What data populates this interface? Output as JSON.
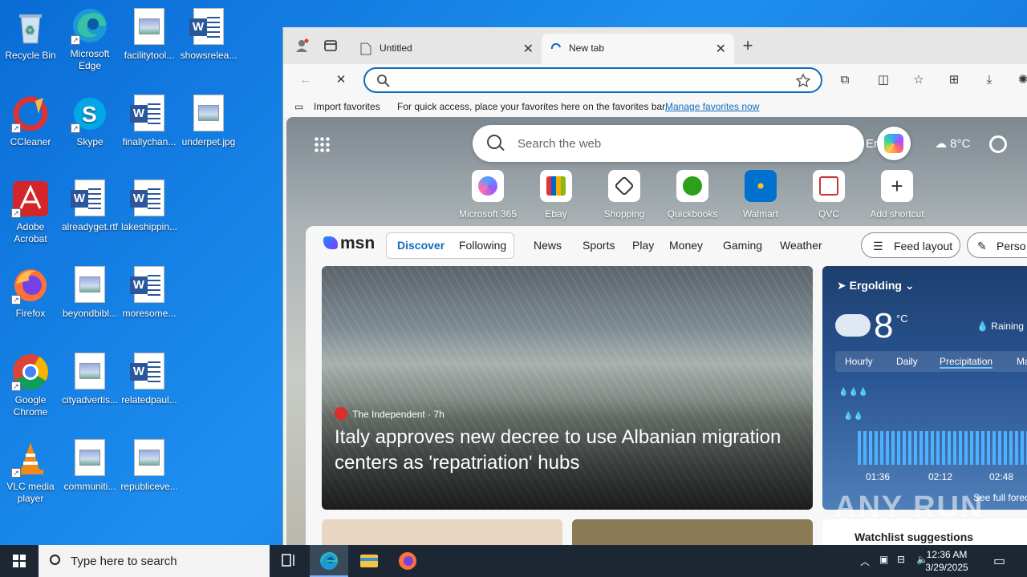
{
  "desktop": {
    "icons": [
      {
        "label": "Recycle Bin"
      },
      {
        "label": "Microsoft Edge"
      },
      {
        "label": "facilitytool..."
      },
      {
        "label": "showsrelea..."
      },
      {
        "label": "CCleaner"
      },
      {
        "label": "Skype"
      },
      {
        "label": "finallychan..."
      },
      {
        "label": "underpet.jpg"
      },
      {
        "label": "Adobe Acrobat"
      },
      {
        "label": "alreadyget.rtf"
      },
      {
        "label": "lakeshippin..."
      },
      {
        "label": "Firefox"
      },
      {
        "label": "beyondbibl..."
      },
      {
        "label": "moresome..."
      },
      {
        "label": "Google Chrome"
      },
      {
        "label": "cityadvertis..."
      },
      {
        "label": "relatedpaul..."
      },
      {
        "label": "VLC media player"
      },
      {
        "label": "communiti..."
      },
      {
        "label": "republiceve..."
      }
    ]
  },
  "browser": {
    "tabs": [
      {
        "label": "Untitled"
      },
      {
        "label": "New tab"
      }
    ],
    "favorites_bar": {
      "import_label": "Import favorites",
      "hint": "For quick access, place your favorites here on the favorites bar.",
      "manage_link": "Manage favorites now"
    }
  },
  "ntp": {
    "search_placeholder": "Search the web",
    "location_peek": "Erolding",
    "top_temp": "8°C",
    "shortcuts": [
      {
        "label": "Microsoft 365"
      },
      {
        "label": "Ebay"
      },
      {
        "label": "Shopping"
      },
      {
        "label": "Quickbooks"
      },
      {
        "label": "Walmart"
      },
      {
        "label": "QVC"
      },
      {
        "label": "Add shortcut"
      }
    ],
    "feed": {
      "logo": "msn",
      "nav": [
        "Discover",
        "Following",
        "News",
        "Sports",
        "Play",
        "Money",
        "Gaming",
        "Weather"
      ],
      "feed_layout": "Feed layout",
      "personalize": "Perso",
      "hero": {
        "source": "The Independent",
        "age": "7h",
        "headline": "Italy approves new decree to use Albanian migration centers as 'repatriation' hubs"
      },
      "weather": {
        "location": "Ergolding",
        "temp": "8",
        "unit": "°C",
        "condition": "Raining n",
        "tabs": [
          "Hourly",
          "Daily",
          "Precipitation",
          "Ma"
        ],
        "times": [
          "01:36",
          "02:12",
          "02:48"
        ],
        "see_full": "See full forec"
      },
      "watchlist": "Watchlist suggestions"
    }
  },
  "watermark": "ANY RUN",
  "taskbar": {
    "search_placeholder": "Type here to search",
    "time": "12:36 AM",
    "date": "3/29/2025"
  }
}
